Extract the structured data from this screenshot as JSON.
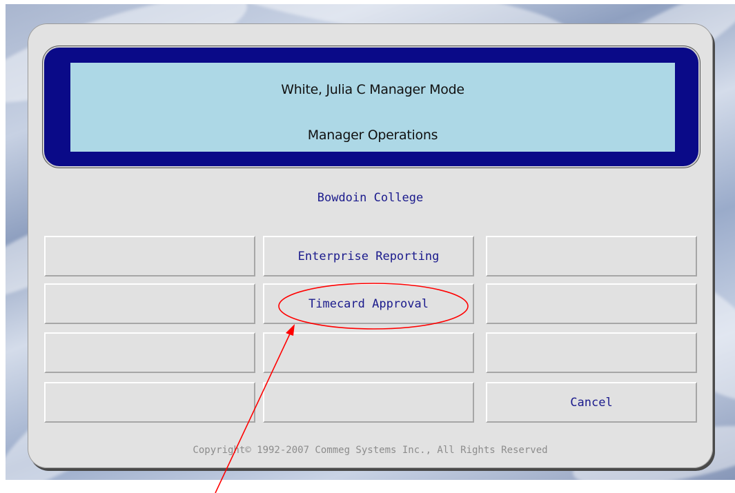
{
  "header": {
    "user_mode": "White, Julia C   Manager Mode",
    "section": "Manager Operations"
  },
  "organization": "Bowdoin College",
  "buttons": [
    {
      "id": "r1c1",
      "label": ""
    },
    {
      "id": "r1c2",
      "label": "Enterprise Reporting"
    },
    {
      "id": "r1c3",
      "label": ""
    },
    {
      "id": "r2c1",
      "label": ""
    },
    {
      "id": "r2c2",
      "label": "Timecard Approval"
    },
    {
      "id": "r2c3",
      "label": ""
    },
    {
      "id": "r3c1",
      "label": ""
    },
    {
      "id": "r3c2",
      "label": ""
    },
    {
      "id": "r3c3",
      "label": ""
    },
    {
      "id": "r4c1",
      "label": ""
    },
    {
      "id": "r4c2",
      "label": ""
    },
    {
      "id": "r4c3",
      "label": "Cancel"
    }
  ],
  "footer": {
    "copyright": "Copyright© 1992-2007 Commeg Systems Inc., All Rights Reserved"
  },
  "annotation": {
    "color": "#ff0000",
    "target": "Timecard Approval"
  }
}
